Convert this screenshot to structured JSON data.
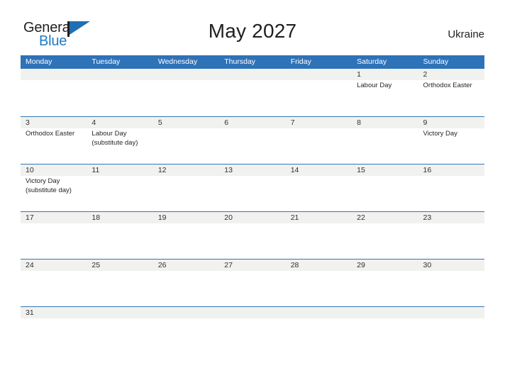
{
  "brand": {
    "name_part1": "General",
    "name_part2": "Blue",
    "flag_icon": "flag-triangle-icon",
    "accent_color": "#1f7ac4"
  },
  "header": {
    "title": "May 2027",
    "country": "Ukraine"
  },
  "theme": {
    "header_row_color": "#2e72b8",
    "week_divider_color": "#3276b5",
    "day_band_color": "#f1f1f0",
    "text_color": "#252525"
  },
  "calendar": {
    "month": "May",
    "year": "2027",
    "weekday_headers": [
      "Monday",
      "Tuesday",
      "Wednesday",
      "Thursday",
      "Friday",
      "Saturday",
      "Sunday"
    ],
    "weeks": [
      [
        {
          "day": "",
          "events": []
        },
        {
          "day": "",
          "events": []
        },
        {
          "day": "",
          "events": []
        },
        {
          "day": "",
          "events": []
        },
        {
          "day": "",
          "events": []
        },
        {
          "day": "1",
          "events": [
            "Labour Day"
          ]
        },
        {
          "day": "2",
          "events": [
            "Orthodox Easter"
          ]
        }
      ],
      [
        {
          "day": "3",
          "events": [
            "Orthodox Easter"
          ]
        },
        {
          "day": "4",
          "events": [
            "Labour Day",
            "(substitute day)"
          ]
        },
        {
          "day": "5",
          "events": []
        },
        {
          "day": "6",
          "events": []
        },
        {
          "day": "7",
          "events": []
        },
        {
          "day": "8",
          "events": []
        },
        {
          "day": "9",
          "events": [
            "Victory Day"
          ]
        }
      ],
      [
        {
          "day": "10",
          "events": [
            "Victory Day",
            "(substitute day)"
          ]
        },
        {
          "day": "11",
          "events": []
        },
        {
          "day": "12",
          "events": []
        },
        {
          "day": "13",
          "events": []
        },
        {
          "day": "14",
          "events": []
        },
        {
          "day": "15",
          "events": []
        },
        {
          "day": "16",
          "events": []
        }
      ],
      [
        {
          "day": "17",
          "events": []
        },
        {
          "day": "18",
          "events": []
        },
        {
          "day": "19",
          "events": []
        },
        {
          "day": "20",
          "events": []
        },
        {
          "day": "21",
          "events": []
        },
        {
          "day": "22",
          "events": []
        },
        {
          "day": "23",
          "events": []
        }
      ],
      [
        {
          "day": "24",
          "events": []
        },
        {
          "day": "25",
          "events": []
        },
        {
          "day": "26",
          "events": []
        },
        {
          "day": "27",
          "events": []
        },
        {
          "day": "28",
          "events": []
        },
        {
          "day": "29",
          "events": []
        },
        {
          "day": "30",
          "events": []
        }
      ],
      [
        {
          "day": "31",
          "events": []
        },
        {
          "day": "",
          "events": []
        },
        {
          "day": "",
          "events": []
        },
        {
          "day": "",
          "events": []
        },
        {
          "day": "",
          "events": []
        },
        {
          "day": "",
          "events": []
        },
        {
          "day": "",
          "events": []
        }
      ]
    ]
  }
}
